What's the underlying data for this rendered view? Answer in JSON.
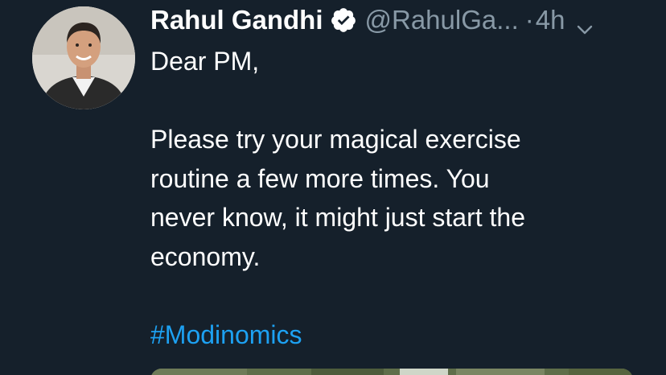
{
  "tweet": {
    "author_name": "Rahul Gandhi",
    "verified_icon": "verified-badge-icon",
    "handle": "@RahulGa...",
    "separator": "·",
    "time": "4h",
    "menu_icon": "chevron-down-icon",
    "avatar_icon": "avatar-photo",
    "lines": [
      "Dear PM,",
      "Please try your magical exercise",
      "routine a few more times. You",
      "never know, it might just start the",
      "economy."
    ],
    "hashtag": "#Modinomics",
    "media_icon": "tweet-media-image"
  },
  "colors": {
    "background": "#15202b",
    "text": "#ffffff",
    "secondary": "#8899a6",
    "link": "#1da1f2"
  }
}
